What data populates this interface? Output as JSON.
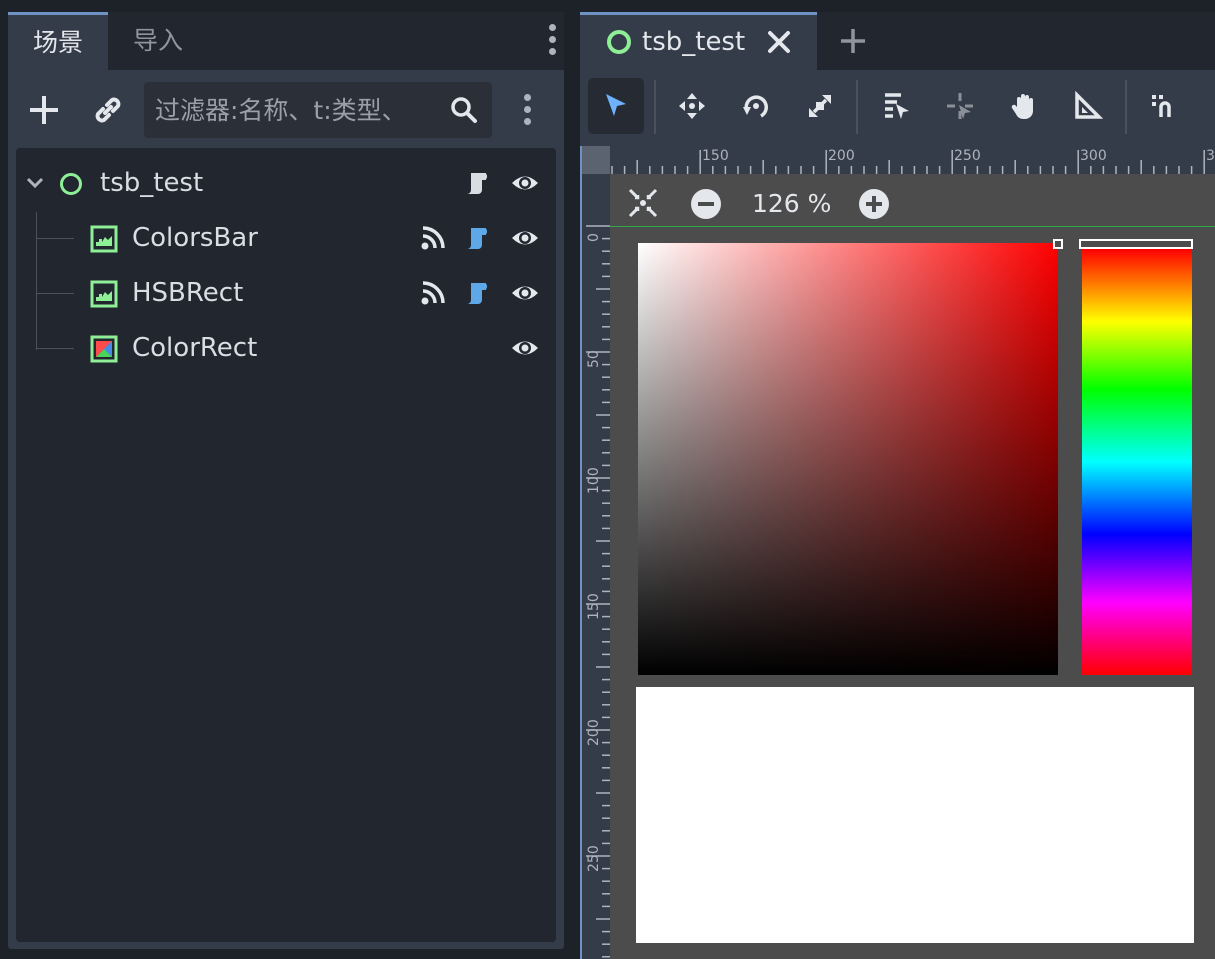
{
  "left_dock": {
    "tabs": [
      {
        "label": "场景",
        "active": true
      },
      {
        "label": "导入",
        "active": false
      }
    ],
    "search": {
      "placeholder": "过滤器:名称、t:类型、"
    },
    "tree": [
      {
        "label": "tsb_test",
        "icon": "node-circle-icon",
        "depth": 0,
        "expanded": true,
        "has_script": true,
        "has_signals": false,
        "visible": true
      },
      {
        "label": "ColorsBar",
        "icon": "texture-rect-icon",
        "depth": 1,
        "has_script": true,
        "has_signals": true,
        "visible": true
      },
      {
        "label": "HSBRect",
        "icon": "texture-rect-icon",
        "depth": 1,
        "has_script": true,
        "has_signals": true,
        "visible": true
      },
      {
        "label": "ColorRect",
        "icon": "color-rect-icon",
        "depth": 1,
        "has_script": false,
        "has_signals": false,
        "visible": true
      }
    ]
  },
  "editor": {
    "tab": {
      "label": "tsb_test"
    },
    "zoom": {
      "level": "126 %"
    },
    "ruler_top": [
      "150",
      "200",
      "250",
      "300",
      "3"
    ],
    "ruler_left": [
      "0",
      "50",
      "100",
      "150",
      "200",
      "250",
      "0"
    ]
  },
  "colors": {
    "accent": "#6f93c4",
    "node_green": "#8eef97",
    "script_blue": "#5fa8e8",
    "panel": "#353c49",
    "tree_bg": "#21262f",
    "viewport_bg": "#4c4c4c"
  }
}
